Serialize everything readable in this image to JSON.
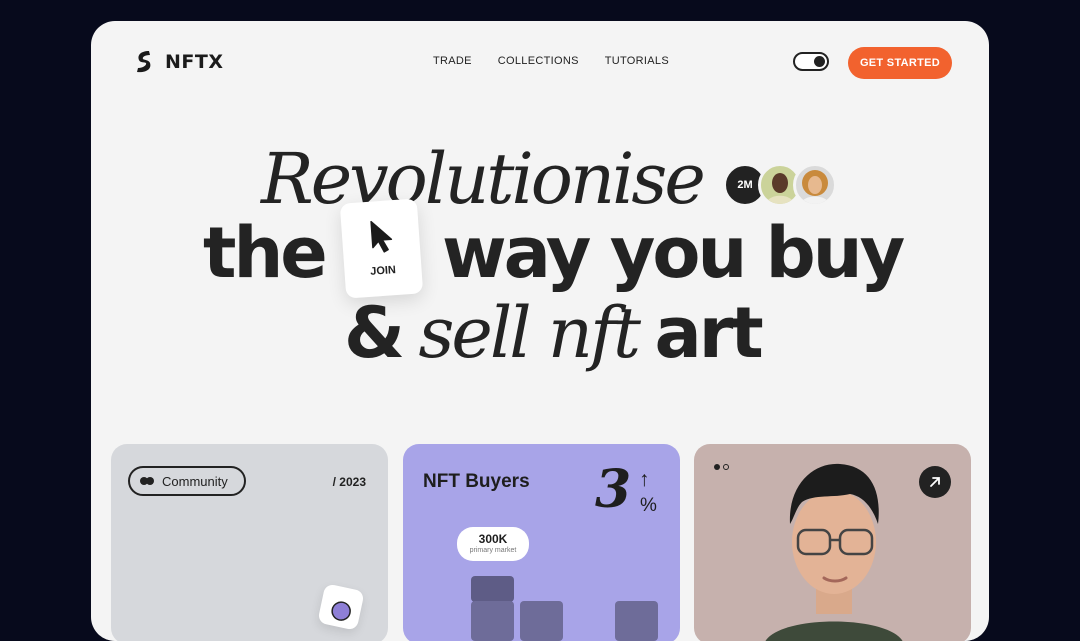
{
  "header": {
    "logo_text": "NFTX",
    "nav": [
      "TRADE",
      "COLLECTIONS",
      "TUTORIALS"
    ],
    "cta_label": "GET STARTED",
    "theme_toggle_on": true
  },
  "hero": {
    "line1": "Revolutionise",
    "line2_a": "the",
    "line2_b": "way you buy",
    "line3_a": "&",
    "line3_b": "sell nft",
    "line3_c": "art",
    "join_label": "JOIN",
    "avatar_count": "2M"
  },
  "cards": {
    "community": {
      "label": "Community",
      "year": "/ 2023"
    },
    "buyers": {
      "title": "NFT Buyers",
      "big_number": "3",
      "arrow": "↑",
      "percent": "%",
      "tooltip_value": "300K",
      "tooltip_label": "primary market"
    }
  },
  "colors": {
    "accent": "#f2622e",
    "background": "#070a1c",
    "frame": "#f4f4f4",
    "buyers_card": "#a8a4e8",
    "community_card": "#d6d8dc",
    "profile_card": "#c6b1ad"
  }
}
